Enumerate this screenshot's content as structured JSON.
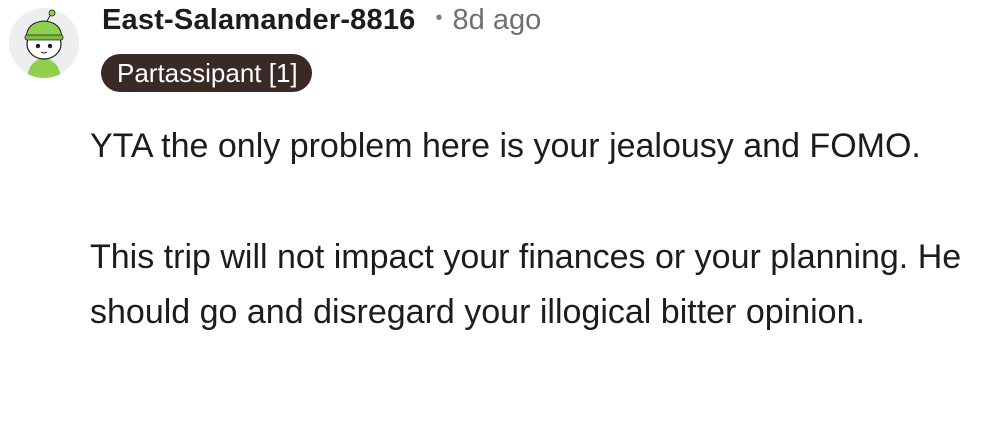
{
  "comment": {
    "avatar_icon": "snoo-avatar-icon",
    "username": "East-Salamander-8816",
    "separator": "•",
    "timestamp": "8d ago",
    "flair": "Partassipant [1]",
    "paragraphs": [
      "YTA the only problem here is your jealousy and FOMO.",
      "This trip will not impact your finances or your planning. He should go and disregard your illogical bitter opinion."
    ]
  },
  "colors": {
    "flair_background": "#3a2a25",
    "flair_text": "#ffffff",
    "text": "#1c1c1c",
    "muted": "#6f6f6f",
    "avatar_green": "#8fd14f"
  }
}
